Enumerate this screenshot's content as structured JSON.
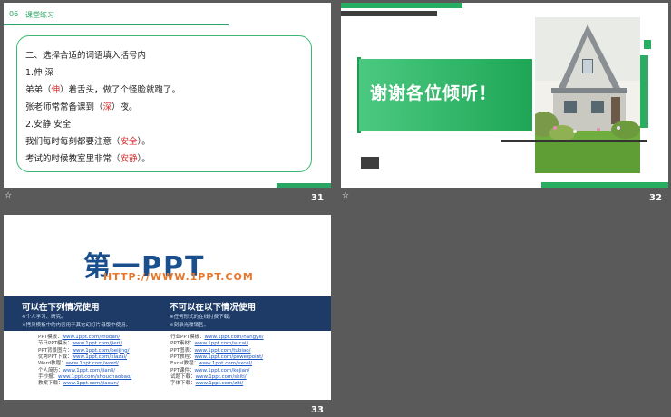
{
  "slides": [
    {
      "number": "31",
      "header": {
        "section_no": "06",
        "section_title": "课堂练习"
      },
      "lines": [
        {
          "pre": "二、选择合适的词语填入括号内",
          "ans": "",
          "post": ""
        },
        {
          "pre": "1.伸  深",
          "ans": "",
          "post": ""
        },
        {
          "pre": "弟弟（",
          "ans": "伸",
          "post": "）着舌头，做了个怪脸就跑了。"
        },
        {
          "pre": "张老师常常备课到（",
          "ans": "深",
          "post": "）夜。"
        },
        {
          "pre": "2.安静  安全",
          "ans": "",
          "post": ""
        },
        {
          "pre": "我们每时每刻都要注意（",
          "ans": "安全",
          "post": "）。"
        },
        {
          "pre": "考试的时候教室里非常（",
          "ans": "安静",
          "post": "）。"
        }
      ]
    },
    {
      "number": "32",
      "thanks": "谢谢各位倾听！",
      "photo": "house-photo"
    },
    {
      "number": "33",
      "logo": {
        "text": "第一PPT",
        "url": "HTTP://WWW.1PPT.COM"
      },
      "left_heading": "可以在下列情况使用",
      "left_items": [
        "※个人学习、研究。",
        "※拷贝模板中的内容用于其它幻灯片母版中使用。"
      ],
      "right_heading": "不可以在以下情况使用",
      "right_items": [
        "※任何形式的在线付费下载。",
        "※刻录光碟销售。"
      ],
      "left_links": [
        {
          "label": "PPT模板：",
          "url": "www.1ppt.com/moban/"
        },
        {
          "label": "节日PPT模板：",
          "url": "www.1ppt.com/jieri/"
        },
        {
          "label": "PPT背景图片：",
          "url": "www.1ppt.com/beijing/"
        },
        {
          "label": "优秀PPT下载：",
          "url": "www.1ppt.com/xiazai/"
        },
        {
          "label": "Word教程：",
          "url": "www.1ppt.com/word/"
        },
        {
          "label": "个人简历：",
          "url": "www.1ppt.com/jianli/"
        },
        {
          "label": "手抄报：",
          "url": "www.1ppt.com/shouchaobao/"
        },
        {
          "label": "教案下载：",
          "url": "www.1ppt.com/jiaoan/"
        }
      ],
      "right_links": [
        {
          "label": "行业PPT模板：",
          "url": "www.1ppt.com/hangye/"
        },
        {
          "label": "PPT素材：",
          "url": "www.1ppt.com/sucai/"
        },
        {
          "label": "PPT图表：",
          "url": "www.1ppt.com/tubiao/"
        },
        {
          "label": "PPT教程：",
          "url": "www.1ppt.com/powerpoint/"
        },
        {
          "label": "Excel教程：",
          "url": "www.1ppt.com/excel/"
        },
        {
          "label": "PPT课件：",
          "url": "www.1ppt.com/kejian/"
        },
        {
          "label": "试题下载：",
          "url": "www.1ppt.com/shiti/"
        },
        {
          "label": "字体下载：",
          "url": "www.1ppt.com/ziti/"
        }
      ]
    }
  ],
  "colors": {
    "background": "#5a5a5a",
    "accent_green": "#27ae60",
    "navy": "#1d3b66",
    "answer_red": "#d42a2a"
  },
  "icons": {
    "transition_marker": "star-icon"
  }
}
